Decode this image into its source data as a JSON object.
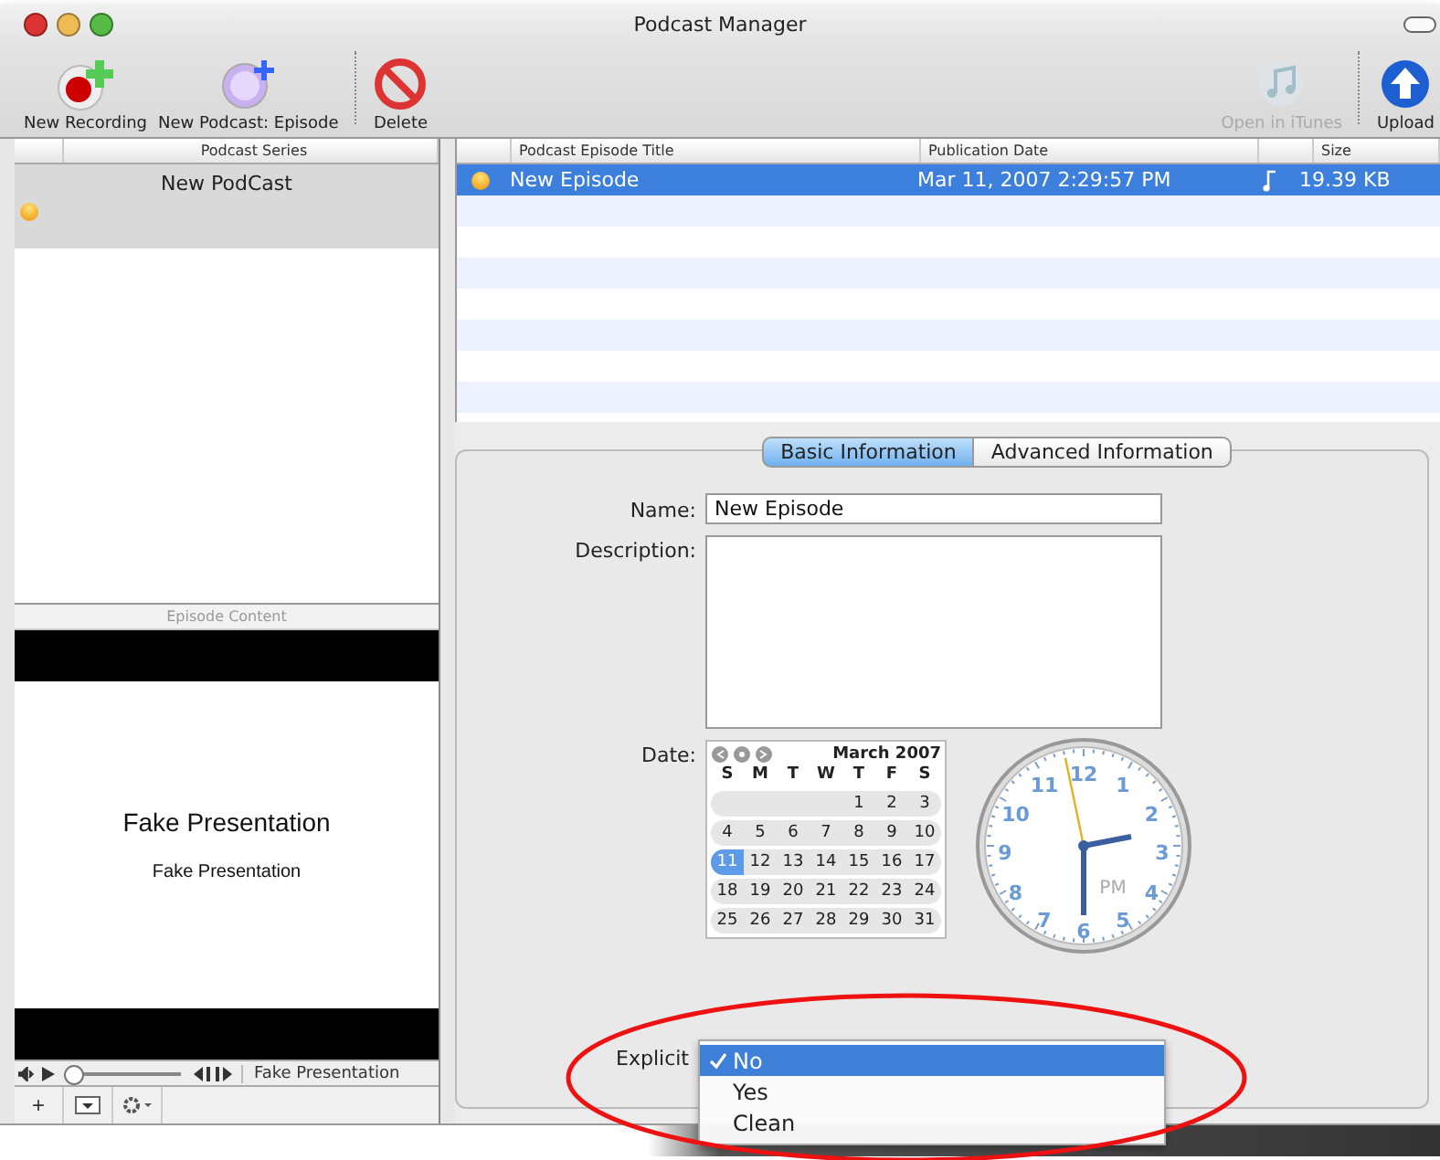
{
  "window": {
    "title": "Podcast Manager"
  },
  "toolbar": {
    "buttons": [
      {
        "label": "New Recording",
        "kind": "record",
        "disabled": false
      },
      {
        "label": "New Podcast: Episode",
        "kind": "episode",
        "disabled": false
      },
      {
        "label": "Delete",
        "kind": "delete",
        "disabled": false
      },
      {
        "label": "Open in iTunes",
        "kind": "itunes",
        "disabled": true
      },
      {
        "label": "Upload",
        "kind": "upload",
        "disabled": false
      }
    ]
  },
  "series_table": {
    "columns": [
      "Podcast Series"
    ],
    "rows": [
      {
        "title": "New PodCast",
        "selected": true
      }
    ]
  },
  "episode_table": {
    "columns": [
      "Podcast Episode Title",
      "Publication Date",
      "Size"
    ],
    "rows": [
      {
        "title": "New Episode",
        "date": "Mar 11, 2007 2:29:57 PM",
        "size": "19.39 KB",
        "selected": true
      }
    ]
  },
  "episode_content": {
    "header": "Episode Content",
    "slide_title": "Fake Presentation",
    "slide_subtitle": "Fake Presentation",
    "player": {
      "level": 0,
      "label": "Fake Presentation"
    },
    "bottom_bar": {
      "add": "+"
    }
  },
  "tabs": [
    {
      "label": "Basic Information",
      "selected": true
    },
    {
      "label": "Advanced Information",
      "selected": false
    }
  ],
  "form": {
    "name_label": "Name:",
    "name_value": "New Episode",
    "description_label": "Description:",
    "date_label": "Date:",
    "calendar": {
      "month": "March 2007",
      "weekdays": [
        "S",
        "M",
        "T",
        "W",
        "T",
        "F",
        "S"
      ],
      "weeks": [
        [
          {
            "d": "1",
            "selected": false
          },
          {
            "d": "2",
            "selected": false
          },
          {
            "d": "3",
            "selected": false
          }
        ],
        [
          {
            "d": "4",
            "selected": false
          },
          {
            "d": "5",
            "selected": false
          },
          {
            "d": "6",
            "selected": false
          },
          {
            "d": "7",
            "selected": false
          },
          {
            "d": "8",
            "selected": false
          },
          {
            "d": "9",
            "selected": false
          },
          {
            "d": "10",
            "selected": false
          }
        ],
        [
          {
            "d": "11",
            "selected": true
          },
          {
            "d": "12",
            "selected": false
          },
          {
            "d": "13",
            "selected": false
          },
          {
            "d": "14",
            "selected": false
          },
          {
            "d": "15",
            "selected": false
          },
          {
            "d": "16",
            "selected": false
          },
          {
            "d": "17",
            "selected": false
          }
        ],
        [
          {
            "d": "18",
            "selected": false
          },
          {
            "d": "19",
            "selected": false
          },
          {
            "d": "20",
            "selected": false
          },
          {
            "d": "21",
            "selected": false
          },
          {
            "d": "22",
            "selected": false
          },
          {
            "d": "23",
            "selected": false
          },
          {
            "d": "24",
            "selected": false
          }
        ],
        [
          {
            "d": "25",
            "selected": false
          },
          {
            "d": "26",
            "selected": false
          },
          {
            "d": "27",
            "selected": false
          },
          {
            "d": "28",
            "selected": false
          },
          {
            "d": "29",
            "selected": false
          },
          {
            "d": "30",
            "selected": false
          },
          {
            "d": "31",
            "selected": false
          }
        ]
      ]
    },
    "clock": {
      "numbers": [
        "12",
        "1",
        "2",
        "3",
        "4",
        "5",
        "6",
        "7",
        "8",
        "9",
        "10",
        "11"
      ],
      "period": "PM"
    },
    "explicit_label": "Explicit",
    "explicit_options": [
      {
        "label": "No",
        "selected": true
      },
      {
        "label": "Yes",
        "selected": false
      },
      {
        "label": "Clean",
        "selected": false
      }
    ]
  }
}
